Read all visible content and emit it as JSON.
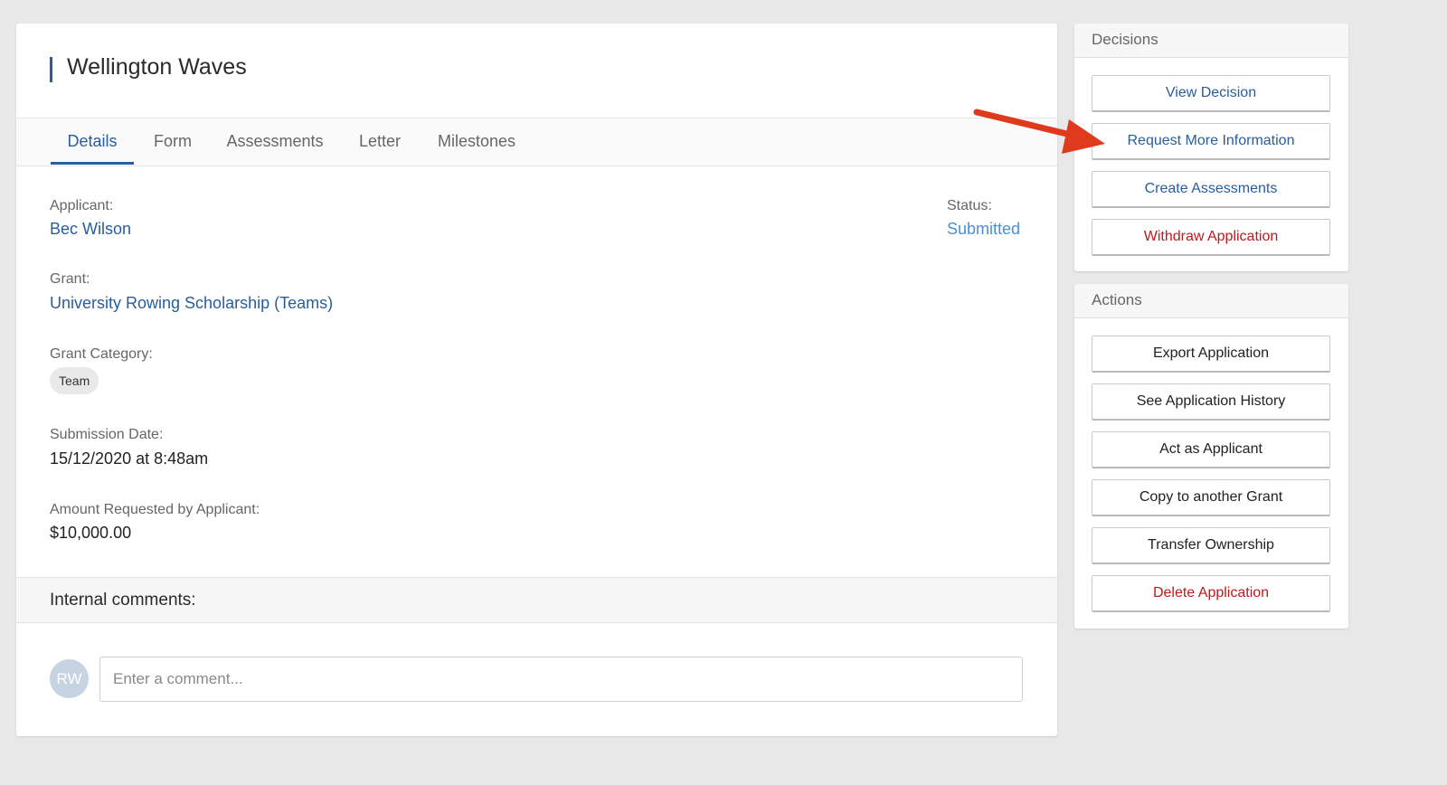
{
  "page": {
    "title": "Wellington Waves",
    "tabs": [
      {
        "label": "Details",
        "active": true
      },
      {
        "label": "Form",
        "active": false
      },
      {
        "label": "Assessments",
        "active": false
      },
      {
        "label": "Letter",
        "active": false
      },
      {
        "label": "Milestones",
        "active": false
      }
    ]
  },
  "details": {
    "applicant_label": "Applicant:",
    "applicant_value": "Bec Wilson",
    "status_label": "Status:",
    "status_value": "Submitted",
    "grant_label": "Grant:",
    "grant_value": "University Rowing Scholarship (Teams)",
    "category_label": "Grant Category:",
    "category_value": "Team",
    "submission_label": "Submission Date:",
    "submission_value": "15/12/2020 at 8:48am",
    "amount_label": "Amount Requested by Applicant:",
    "amount_value": "$10,000.00"
  },
  "comments": {
    "title": "Internal comments:",
    "avatar_initials": "RW",
    "placeholder": "Enter a comment..."
  },
  "decisions": {
    "header": "Decisions",
    "buttons": [
      {
        "label": "View Decision",
        "style": "link"
      },
      {
        "label": "Request More Information",
        "style": "link"
      },
      {
        "label": "Create Assessments",
        "style": "link"
      },
      {
        "label": "Withdraw Application",
        "style": "danger"
      }
    ]
  },
  "actions": {
    "header": "Actions",
    "buttons": [
      {
        "label": "Export Application",
        "style": "dark"
      },
      {
        "label": "See Application History",
        "style": "dark"
      },
      {
        "label": "Act as Applicant",
        "style": "dark"
      },
      {
        "label": "Copy to another Grant",
        "style": "dark"
      },
      {
        "label": "Transfer Ownership",
        "style": "dark"
      },
      {
        "label": "Delete Application",
        "style": "danger"
      }
    ]
  },
  "colors": {
    "accent": "#2a5d9c",
    "status": "#4a90d9",
    "danger": "#c0181c",
    "annotation_arrow": "#e03a1e"
  },
  "annotation": {
    "icon": "red-arrow-icon",
    "points_to": "Request More Information"
  }
}
